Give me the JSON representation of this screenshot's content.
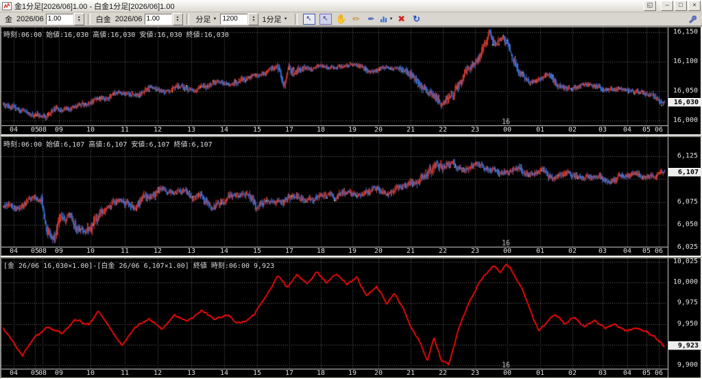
{
  "window": {
    "title": "金1分足[2026/06]1.00 - 白金1分足[2026/06]1.00",
    "float_glyph": "◱",
    "min_glyph": "–",
    "max_glyph": "□",
    "close_glyph": "×"
  },
  "toolbar": {
    "gold_label": "金",
    "gold_month": "2026/06",
    "gold_value": "1.00",
    "plat_label": "白金",
    "plat_month": "2026/06",
    "plat_value": "1.00",
    "bar_type": "分足",
    "bar_count": "1200",
    "interval": "1分足"
  },
  "time_axis": {
    "labels": [
      [
        "04",
        18
      ],
      [
        "05",
        49
      ],
      [
        "08",
        60
      ],
      [
        "09",
        84
      ],
      [
        "10",
        130
      ],
      [
        "11",
        180
      ],
      [
        "12",
        228
      ],
      [
        "13",
        277
      ],
      [
        "14",
        325
      ],
      [
        "15",
        373
      ],
      [
        "17",
        420
      ],
      [
        "18",
        466
      ],
      [
        "19",
        512
      ],
      [
        "20",
        550
      ],
      [
        "21",
        597
      ],
      [
        "22",
        644
      ],
      [
        "23",
        691
      ],
      [
        "00",
        738
      ],
      [
        "01",
        786
      ],
      [
        "02",
        833
      ],
      [
        "03",
        877
      ],
      [
        "04",
        913
      ],
      [
        "05",
        941
      ],
      [
        "06",
        959
      ]
    ],
    "date_marker": {
      "label": "16",
      "x": 735
    }
  },
  "chart_data": [
    {
      "name": "gold-1min-candles",
      "type": "candlestick",
      "seed": 9,
      "info": "時刻:06:00 始値:16,030 高値:16,030 安値:16,030 終値:16,030",
      "v_top": 16158,
      "v_bottom": 15992,
      "gridlines": [
        16150,
        16100,
        16050,
        16000
      ],
      "y_ticks": [
        {
          "v": 16150,
          "label": "16,150"
        },
        {
          "v": 16100,
          "label": "16,100"
        },
        {
          "v": 16050,
          "label": "16,050"
        },
        {
          "v": 16000,
          "label": "16,000"
        }
      ],
      "last": {
        "v": 16030,
        "label": "16,030"
      },
      "colors": {
        "up": "#e23b2e",
        "down": "#3d77e0",
        "spark": "#ffe97a"
      },
      "noise": {
        "walk": 2.4,
        "wick": 3.4
      },
      "keypoints": [
        [
          0,
          16028
        ],
        [
          0.02,
          16017
        ],
        [
          0.045,
          16012
        ],
        [
          0.06,
          16006
        ],
        [
          0.08,
          16017
        ],
        [
          0.1,
          16021
        ],
        [
          0.13,
          16030
        ],
        [
          0.16,
          16041
        ],
        [
          0.175,
          16048
        ],
        [
          0.2,
          16043
        ],
        [
          0.225,
          16056
        ],
        [
          0.25,
          16050
        ],
        [
          0.27,
          16059
        ],
        [
          0.285,
          16052
        ],
        [
          0.3,
          16057
        ],
        [
          0.325,
          16068
        ],
        [
          0.345,
          16061
        ],
        [
          0.37,
          16076
        ],
        [
          0.4,
          16082
        ],
        [
          0.415,
          16090
        ],
        [
          0.425,
          16062
        ],
        [
          0.432,
          16095
        ],
        [
          0.44,
          16078
        ],
        [
          0.455,
          16088
        ],
        [
          0.47,
          16092
        ],
        [
          0.5,
          16088
        ],
        [
          0.53,
          16093
        ],
        [
          0.555,
          16084
        ],
        [
          0.58,
          16091
        ],
        [
          0.6,
          16089
        ],
        [
          0.615,
          16078
        ],
        [
          0.635,
          16055
        ],
        [
          0.652,
          16042
        ],
        [
          0.665,
          16028
        ],
        [
          0.68,
          16047
        ],
        [
          0.7,
          16080
        ],
        [
          0.72,
          16112
        ],
        [
          0.735,
          16149
        ],
        [
          0.745,
          16128
        ],
        [
          0.755,
          16140
        ],
        [
          0.765,
          16118
        ],
        [
          0.78,
          16082
        ],
        [
          0.795,
          16063
        ],
        [
          0.81,
          16070
        ],
        [
          0.825,
          16077
        ],
        [
          0.84,
          16063
        ],
        [
          0.86,
          16056
        ],
        [
          0.88,
          16062
        ],
        [
          0.9,
          16056
        ],
        [
          0.92,
          16050
        ],
        [
          0.94,
          16054
        ],
        [
          0.96,
          16049
        ],
        [
          0.98,
          16042
        ],
        [
          1.0,
          16030
        ]
      ]
    },
    {
      "name": "platinum-1min-candles",
      "type": "candlestick",
      "seed": 23,
      "info": "時刻:06:00 始値:6,107 高値:6,107 安値:6,107 終値:6,107",
      "v_top": 6146,
      "v_bottom": 6026,
      "gridlines": [
        6125,
        6100,
        6075,
        6050,
        6025
      ],
      "y_ticks": [
        {
          "v": 6125,
          "label": "6,125"
        },
        {
          "v": 6075,
          "label": "6,075"
        },
        {
          "v": 6050,
          "label": "6,050"
        },
        {
          "v": 6025,
          "label": "6,025"
        }
      ],
      "last": {
        "v": 6107,
        "label": "6,107"
      },
      "colors": {
        "up": "#e23b2e",
        "down": "#3d77e0",
        "spark": "#ffe97a"
      },
      "noise": {
        "walk": 2.2,
        "wick": 2.8
      },
      "keypoints": [
        [
          0,
          6072
        ],
        [
          0.02,
          6068
        ],
        [
          0.04,
          6076
        ],
        [
          0.058,
          6079
        ],
        [
          0.068,
          6042
        ],
        [
          0.075,
          6034
        ],
        [
          0.085,
          6054
        ],
        [
          0.1,
          6061
        ],
        [
          0.115,
          6047
        ],
        [
          0.125,
          6041
        ],
        [
          0.14,
          6059
        ],
        [
          0.16,
          6070
        ],
        [
          0.18,
          6077
        ],
        [
          0.2,
          6068
        ],
        [
          0.22,
          6081
        ],
        [
          0.24,
          6090
        ],
        [
          0.26,
          6085
        ],
        [
          0.275,
          6089
        ],
        [
          0.295,
          6080
        ],
        [
          0.315,
          6069
        ],
        [
          0.33,
          6078
        ],
        [
          0.35,
          6086
        ],
        [
          0.37,
          6081
        ],
        [
          0.385,
          6071
        ],
        [
          0.4,
          6078
        ],
        [
          0.42,
          6074
        ],
        [
          0.44,
          6082
        ],
        [
          0.46,
          6077
        ],
        [
          0.48,
          6085
        ],
        [
          0.5,
          6080
        ],
        [
          0.52,
          6088
        ],
        [
          0.54,
          6082
        ],
        [
          0.56,
          6089
        ],
        [
          0.58,
          6084
        ],
        [
          0.6,
          6091
        ],
        [
          0.62,
          6096
        ],
        [
          0.64,
          6106
        ],
        [
          0.655,
          6121
        ],
        [
          0.665,
          6111
        ],
        [
          0.678,
          6118
        ],
        [
          0.695,
          6109
        ],
        [
          0.715,
          6116
        ],
        [
          0.735,
          6111
        ],
        [
          0.755,
          6107
        ],
        [
          0.775,
          6112
        ],
        [
          0.795,
          6104
        ],
        [
          0.815,
          6109
        ],
        [
          0.835,
          6100
        ],
        [
          0.855,
          6106
        ],
        [
          0.875,
          6101
        ],
        [
          0.895,
          6105
        ],
        [
          0.915,
          6099
        ],
        [
          0.935,
          6104
        ],
        [
          0.955,
          6106
        ],
        [
          0.975,
          6103
        ],
        [
          1.0,
          6107
        ]
      ]
    },
    {
      "name": "gold-platinum-spread-line",
      "type": "line",
      "seed": 5,
      "info": "[金 26/06 16,030×1.00]-[白金 26/06 6,107×1.00] 終値 時刻:06:00 9,923",
      "v_top": 10029,
      "v_bottom": 9896,
      "gridlines": [
        10025,
        10000,
        9975,
        9950,
        9925,
        9900
      ],
      "y_ticks": [
        {
          "v": 10025,
          "label": "10,025"
        },
        {
          "v": 10000,
          "label": "10,000"
        },
        {
          "v": 9975,
          "label": "9,975"
        },
        {
          "v": 9950,
          "label": "9,950"
        },
        {
          "v": 9925,
          "label": "9,925"
        },
        {
          "v": 9900,
          "label": "9,900"
        }
      ],
      "last": {
        "v": 9923,
        "label": "9,923"
      },
      "colors": {
        "line": "#fe0a0a"
      },
      "noise": {
        "walk": 1.7
      },
      "keypoints": [
        [
          0,
          9945
        ],
        [
          0.015,
          9929
        ],
        [
          0.03,
          9912
        ],
        [
          0.05,
          9936
        ],
        [
          0.07,
          9946
        ],
        [
          0.09,
          9939
        ],
        [
          0.11,
          9956
        ],
        [
          0.13,
          9949
        ],
        [
          0.145,
          9966
        ],
        [
          0.16,
          9949
        ],
        [
          0.18,
          9924
        ],
        [
          0.2,
          9946
        ],
        [
          0.22,
          9956
        ],
        [
          0.24,
          9944
        ],
        [
          0.26,
          9961
        ],
        [
          0.28,
          9954
        ],
        [
          0.3,
          9966
        ],
        [
          0.32,
          9955
        ],
        [
          0.34,
          9961
        ],
        [
          0.36,
          9950
        ],
        [
          0.38,
          9961
        ],
        [
          0.4,
          9986
        ],
        [
          0.415,
          10006
        ],
        [
          0.43,
          9994
        ],
        [
          0.445,
          10011
        ],
        [
          0.46,
          9999
        ],
        [
          0.475,
          10013
        ],
        [
          0.49,
          10000
        ],
        [
          0.505,
          10011
        ],
        [
          0.52,
          9997
        ],
        [
          0.535,
          10008
        ],
        [
          0.55,
          9984
        ],
        [
          0.565,
          9996
        ],
        [
          0.58,
          9975
        ],
        [
          0.592,
          9986
        ],
        [
          0.605,
          9968
        ],
        [
          0.618,
          9944
        ],
        [
          0.63,
          9928
        ],
        [
          0.642,
          9908
        ],
        [
          0.652,
          9936
        ],
        [
          0.664,
          9904
        ],
        [
          0.674,
          9901
        ],
        [
          0.688,
          9941
        ],
        [
          0.702,
          9972
        ],
        [
          0.716,
          9996
        ],
        [
          0.73,
          10011
        ],
        [
          0.742,
          10021
        ],
        [
          0.752,
          10013
        ],
        [
          0.762,
          10023
        ],
        [
          0.774,
          10009
        ],
        [
          0.786,
          9992
        ],
        [
          0.798,
          9965
        ],
        [
          0.81,
          9942
        ],
        [
          0.822,
          9952
        ],
        [
          0.835,
          9961
        ],
        [
          0.85,
          9950
        ],
        [
          0.865,
          9958
        ],
        [
          0.88,
          9946
        ],
        [
          0.895,
          9953
        ],
        [
          0.91,
          9944
        ],
        [
          0.925,
          9950
        ],
        [
          0.94,
          9941
        ],
        [
          0.955,
          9946
        ],
        [
          0.97,
          9941
        ],
        [
          0.985,
          9934
        ],
        [
          1.0,
          9923
        ]
      ]
    }
  ]
}
